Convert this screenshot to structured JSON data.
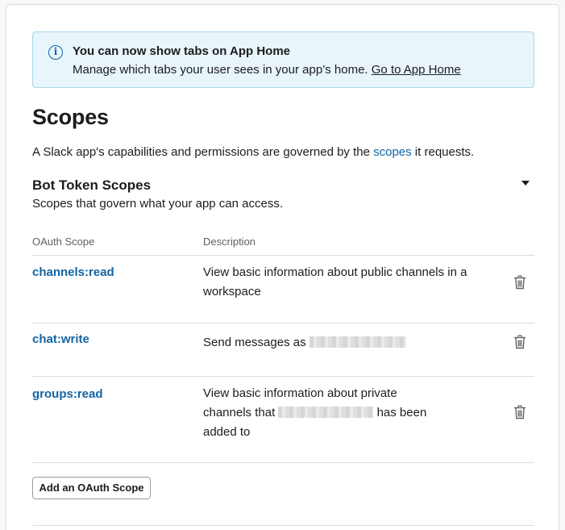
{
  "banner": {
    "title": "You can now show tabs on App Home",
    "text": "Manage which tabs your user sees in your app’s home. ",
    "link": "Go to App Home",
    "icon": "info-icon"
  },
  "page": {
    "title": "Scopes",
    "subtitle_before": "A Slack app's capabilities and permissions are governed by the ",
    "subtitle_link": "scopes",
    "subtitle_after": " it requests."
  },
  "bot_scopes": {
    "title": "Bot Token Scopes",
    "description": "Scopes that govern what your app can access.",
    "column_scope": "OAuth Scope",
    "column_description": "Description",
    "rows": [
      {
        "name": "channels:read",
        "description": "View basic information about public channels in a workspace"
      },
      {
        "name": "chat:write",
        "description_before": "Send messages as "
      },
      {
        "name": "groups:read",
        "description_before": "View basic information about private channels that ",
        "description_after": " has been added to"
      }
    ],
    "add_button": "Add an OAuth Scope"
  },
  "colors": {
    "accent": "#1264a3",
    "banner_bg": "#e8f5fa",
    "banner_border": "#a9d7ea"
  }
}
